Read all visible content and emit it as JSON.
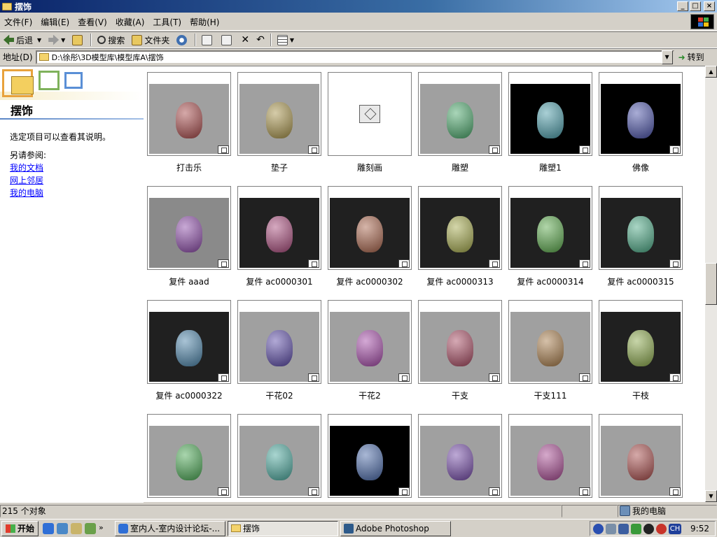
{
  "window": {
    "title": "摆饰",
    "min": "_",
    "max": "□",
    "close": "×"
  },
  "menu": [
    "文件(F)",
    "编辑(E)",
    "查看(V)",
    "收藏(A)",
    "工具(T)",
    "帮助(H)"
  ],
  "toolbar": {
    "back": "后退",
    "search": "搜索",
    "folders": "文件夹"
  },
  "address": {
    "label": "地址(D)",
    "value": "D:\\徐彤\\3D模型库\\模型库A\\摆饰",
    "goto": "转到"
  },
  "leftpane": {
    "title": "摆饰",
    "description": "选定项目可以查看其说明。",
    "see_also": "另请参阅:",
    "links": [
      "我的文档",
      "网上邻居",
      "我的电脑"
    ]
  },
  "items": [
    {
      "name": "打击乐",
      "bg": "gray"
    },
    {
      "name": "垫子",
      "bg": "gray"
    },
    {
      "name": "雕刻画",
      "bg": "white"
    },
    {
      "name": "雕塑",
      "bg": "gray"
    },
    {
      "name": "雕塑1",
      "bg": "black"
    },
    {
      "name": "佛像",
      "bg": "black"
    },
    {
      "name": "复件 aaad",
      "bg": "gray2"
    },
    {
      "name": "复件 ac0000301",
      "bg": "dark"
    },
    {
      "name": "复件 ac0000302",
      "bg": "dark"
    },
    {
      "name": "复件 ac0000313",
      "bg": "dark"
    },
    {
      "name": "复件 ac0000314",
      "bg": "dark"
    },
    {
      "name": "复件 ac0000315",
      "bg": "dark"
    },
    {
      "name": "复件 ac0000322",
      "bg": "dark"
    },
    {
      "name": "干花02",
      "bg": "gray"
    },
    {
      "name": "干花2",
      "bg": "gray"
    },
    {
      "name": "干支",
      "bg": "gray"
    },
    {
      "name": "干支111",
      "bg": "gray"
    },
    {
      "name": "干枝",
      "bg": "dark"
    },
    {
      "name": "",
      "bg": "gray"
    },
    {
      "name": "",
      "bg": "gray"
    },
    {
      "name": "",
      "bg": "black"
    },
    {
      "name": "",
      "bg": "gray"
    },
    {
      "name": "",
      "bg": "gray"
    },
    {
      "name": "",
      "bg": "gray"
    }
  ],
  "status": {
    "count": "215 个对象",
    "zone": "我的电脑"
  },
  "taskbar": {
    "start": "开始",
    "tasks": [
      "室内人-室内设计论坛-...",
      "摆饰",
      "Adobe Photoshop"
    ],
    "lang": "CH",
    "clock": "9:52"
  }
}
